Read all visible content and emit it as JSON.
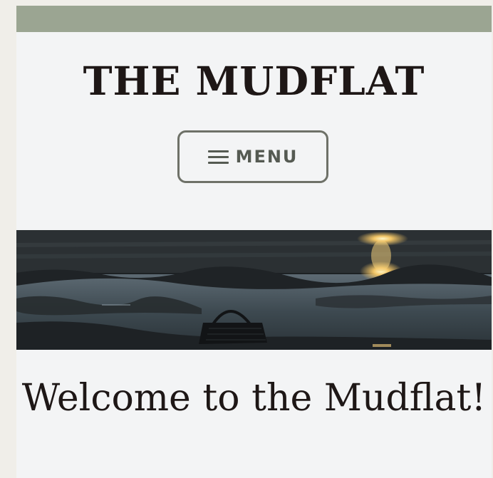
{
  "header": {
    "site_title": "THE MUDFLAT",
    "menu_label": "MENU",
    "menu_icon": "hamburger-icon"
  },
  "hero": {
    "image": "sunset-mudflat-with-basket-photo"
  },
  "main": {
    "heading": "Welcome to the Mudflat!"
  },
  "colors": {
    "accent_band": "#9ba592",
    "page_bg": "#f3f4f5",
    "outer_bg": "#f0eee9",
    "title_text": "#1e1716",
    "menu_border": "#6e7168",
    "menu_text": "#555a52"
  }
}
